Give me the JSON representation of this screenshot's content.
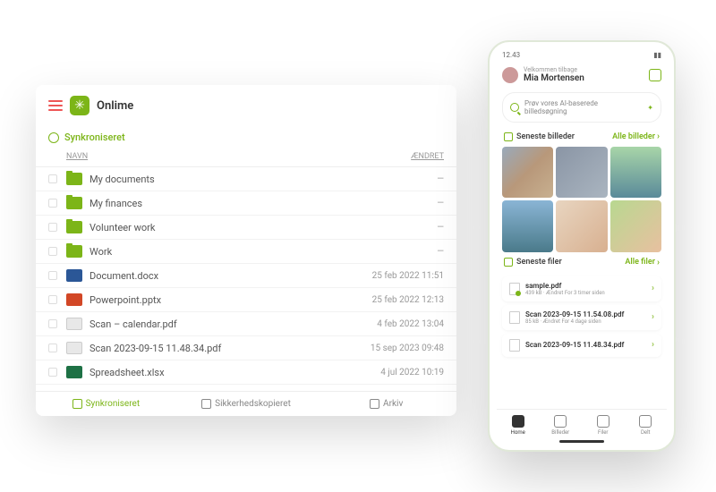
{
  "desktop": {
    "brand": "Onlime",
    "sync_label": "Synkroniseret",
    "col_name": "NAVN",
    "col_modified": "ÆNDRET",
    "rows": [
      {
        "type": "folder",
        "name": "My documents",
        "modified": "—"
      },
      {
        "type": "folder",
        "name": "My finances",
        "modified": "—"
      },
      {
        "type": "folder",
        "name": "Volunteer work",
        "modified": "—"
      },
      {
        "type": "folder",
        "name": "Work",
        "modified": "—"
      },
      {
        "type": "docx",
        "name": "Document.docx",
        "modified": "25 feb 2022 11:51"
      },
      {
        "type": "pptx",
        "name": "Powerpoint.pptx",
        "modified": "25 feb 2022 12:13"
      },
      {
        "type": "pdf",
        "name": "Scan – calendar.pdf",
        "modified": "4 feb 2022 13:04"
      },
      {
        "type": "pdf",
        "name": "Scan 2023-09-15 11.48.34.pdf",
        "modified": "15 sep 2023 09:48"
      },
      {
        "type": "xlsx",
        "name": "Spreadsheet.xlsx",
        "modified": "4 jul 2022 10:19"
      }
    ],
    "tabs": [
      {
        "label": "Synkroniseret",
        "active": true
      },
      {
        "label": "Sikkerhedskopieret",
        "active": false
      },
      {
        "label": "Arkiv",
        "active": false
      }
    ]
  },
  "phone": {
    "status_time": "12.43",
    "greeting_small": "Velkommen tilbage",
    "greeting_name": "Mia Mortensen",
    "search_placeholder": "Prøv vores AI-baserede billedsøgning",
    "section_images": "Seneste billeder",
    "link_images": "Alle billeder",
    "section_files": "Seneste filer",
    "link_files": "Alle filer",
    "files": [
      {
        "name": "sample.pdf",
        "meta": "439 kB · Ændret For 3 timer siden",
        "ok": true
      },
      {
        "name": "Scan 2023-09-15 11.54.08.pdf",
        "meta": "85 kB · Ændret For 4 dage siden",
        "ok": false
      },
      {
        "name": "Scan 2023-09-15 11.48.34.pdf",
        "meta": "",
        "ok": false
      }
    ],
    "nav": [
      {
        "label": "Home",
        "active": true
      },
      {
        "label": "Billeder",
        "active": false
      },
      {
        "label": "Filer",
        "active": false
      },
      {
        "label": "Delt",
        "active": false
      }
    ]
  }
}
